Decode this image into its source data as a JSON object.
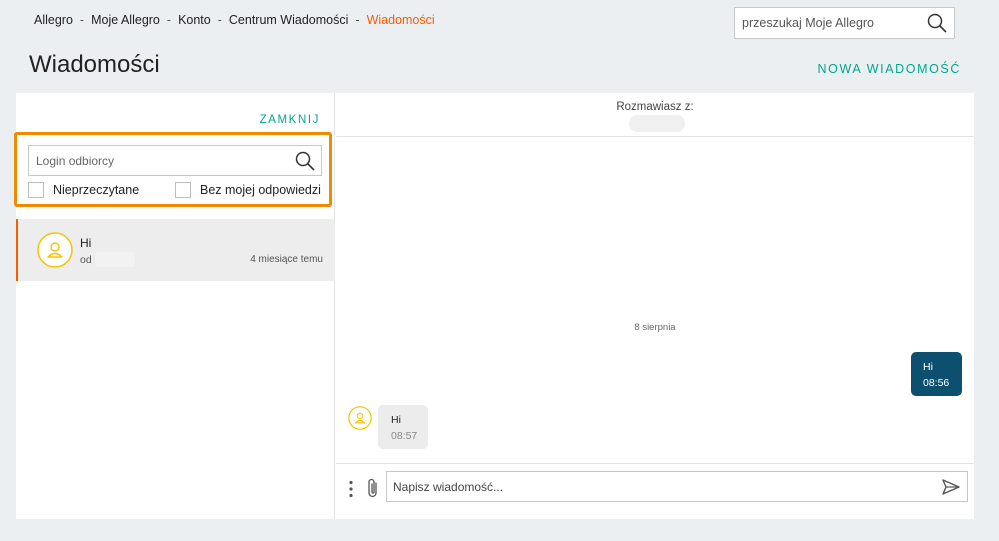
{
  "breadcrumb": {
    "items": [
      "Allegro",
      "Moje Allegro",
      "Konto",
      "Centrum Wiadomości"
    ],
    "current": "Wiadomości",
    "separator": "-"
  },
  "header": {
    "search_placeholder": "przeszukaj Moje Allegro",
    "page_title": "Wiadomości",
    "new_message_label": "NOWA WIADOMOŚĆ"
  },
  "sidebar": {
    "close_label": "ZAMKNIJ",
    "login_placeholder": "Login odbiorcy",
    "filters": {
      "unread_label": "Nieprzeczytane",
      "no_reply_label": "Bez mojej odpowiedzi"
    },
    "threads": [
      {
        "subject": "Hi",
        "from_label": "od",
        "time": "4 miesiące temu"
      }
    ]
  },
  "chat": {
    "talking_with_label": "Rozmawiasz z:",
    "date_separator": "8 sierpnia",
    "messages": [
      {
        "direction": "out",
        "text": "Hi",
        "time": "08:56"
      },
      {
        "direction": "in",
        "text": "Hi",
        "time": "08:57"
      }
    ],
    "composer_placeholder": "Napisz wiadomość..."
  },
  "colors": {
    "accent_teal": "#00a790",
    "accent_orange": "#ff5a00",
    "highlight_orange": "#f18a00",
    "outgoing_bubble": "#0c4f6e",
    "avatar_yellow": "#f5c400"
  },
  "icons": {
    "search": "search-icon",
    "avatar": "user-avatar-icon",
    "more": "more-vertical-icon",
    "attach": "paperclip-icon",
    "send": "send-icon"
  }
}
